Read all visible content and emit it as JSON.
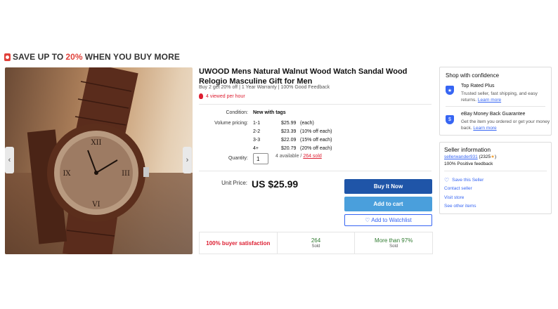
{
  "promo": {
    "prefix": "SAVE UP TO",
    "highlight": "20%",
    "suffix": "WHEN YOU BUY MORE"
  },
  "product": {
    "title": "UWOOD Mens Natural Walnut Wood Watch Sandal Wood Relogio Masculine Gift for Men",
    "subtitle": "Buy 2 get 20% off | 1 Year Warranty | 100% Good Feedback",
    "viewed": "4 viewed per hour",
    "condition_label": "Condition:",
    "condition_value": "New with tags",
    "volume_label": "Volume pricing:",
    "volume_tiers": [
      {
        "qty": "1-1",
        "price": "$25.99",
        "note": "(each)"
      },
      {
        "qty": "2-2",
        "price": "$23.39",
        "note": "(10% off each)"
      },
      {
        "qty": "3-3",
        "price": "$22.09",
        "note": "(15% off each)"
      },
      {
        "qty": "4+",
        "price": "$20.79",
        "note": "(20% off each)"
      }
    ],
    "quantity_label": "Quantity:",
    "quantity_value": "1",
    "available": "4 available /",
    "sold": "264 sold",
    "unit_price_label": "Unit Price:",
    "unit_price": "US $25.99"
  },
  "actions": {
    "buy_now": "Buy It Now",
    "add_to_cart": "Add to cart",
    "watchlist": "♡ Add to Watchlist"
  },
  "stats": {
    "satisfaction": "100% buyer satisfaction",
    "sold_count": "264",
    "sold_label": "Sold",
    "more_than": "More than 97%",
    "more_than_label": "Sold"
  },
  "confidence": {
    "heading": "Shop with confidence",
    "items": [
      {
        "title": "Top Rated Plus",
        "text": "Trusted seller, fast shipping, and easy returns.",
        "link": "Learn more",
        "icon": "top-rated-icon"
      },
      {
        "title": "eBay Money Back Guarantee",
        "text": "Get the item you ordered or get your money back.",
        "link": "Learn more",
        "icon": "shield-icon"
      }
    ]
  },
  "seller": {
    "heading": "Seller information",
    "name": "sellerwander931",
    "rating": "(2325",
    "rating_end": ")",
    "feedback": "100% Positive feedback",
    "save_seller": "Save this Seller",
    "contact": "Contact seller",
    "visit": "Visit store",
    "other": "See other items"
  },
  "colors": {
    "accent_red": "#e0413a",
    "primary_blue": "#1f55a8",
    "cart_blue": "#4a9fdc",
    "link_blue": "#3665f3",
    "green": "#2f7a2f"
  }
}
